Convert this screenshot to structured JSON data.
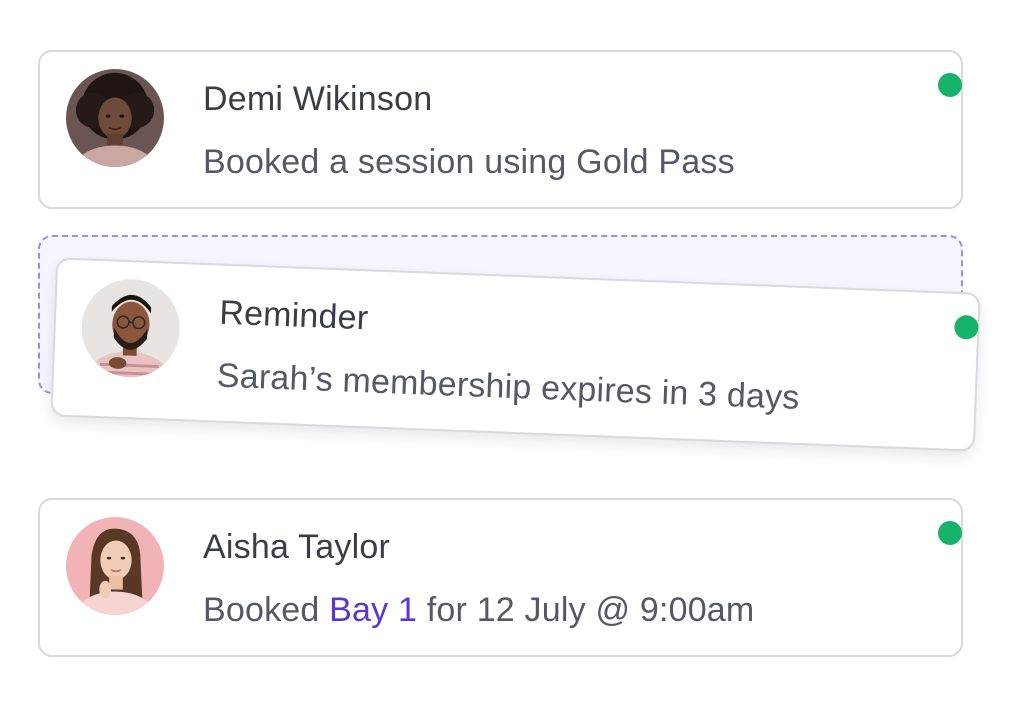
{
  "notifications": [
    {
      "name": "Demi Wikinson",
      "message": "Booked a session using Gold Pass",
      "avatar_icon": "person-avatar-icon",
      "status_color": "#17b26a"
    },
    {
      "name": "Reminder",
      "message": "Sarah’s membership expires in 3 days",
      "avatar_icon": "person-avatar-icon",
      "status_color": "#17b26a",
      "state": "dragging"
    },
    {
      "name": "Aisha Taylor",
      "message_prefix": "Booked ",
      "message_highlight": "Bay 1",
      "message_suffix": " for 12 July @ 9:00am",
      "avatar_icon": "person-avatar-icon",
      "status_color": "#17b26a"
    }
  ],
  "colors": {
    "accent": "#5b35d5",
    "status_online": "#17b26a",
    "drop_zone_border": "#9a8cf0",
    "drop_zone_fill": "#f7f5ff"
  }
}
